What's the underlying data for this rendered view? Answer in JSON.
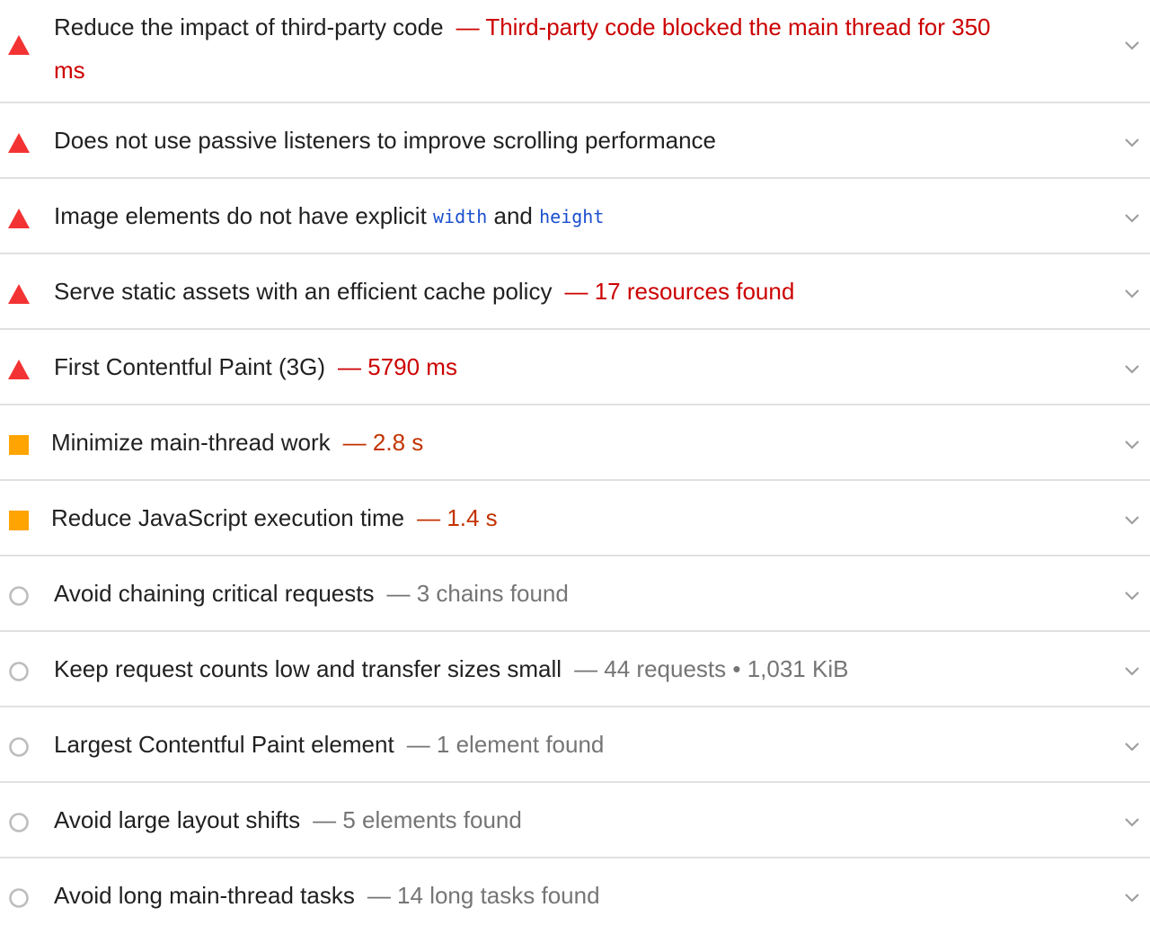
{
  "colors": {
    "fail": "#f33333",
    "fail_text": "#cc0000",
    "average": "#ffa400",
    "average_text": "#c33300",
    "informative": "#bdbdbd",
    "informative_text": "#757575",
    "chevron": "#9e9e9e",
    "divider": "#e0e0e0"
  },
  "audits": [
    {
      "status": "fail",
      "icon": "fail-triangle-icon",
      "title": "Reduce the impact of third-party code",
      "display_value": "— Third-party code blocked the main thread for 350 ms"
    },
    {
      "status": "fail",
      "icon": "fail-triangle-icon",
      "title": "Does not use passive listeners to improve scrolling performance",
      "display_value": ""
    },
    {
      "status": "fail",
      "icon": "fail-triangle-icon",
      "title_part1": "Image elements do not have explicit",
      "code1": "width",
      "title_part2": "and",
      "code2": "height",
      "display_value": ""
    },
    {
      "status": "fail",
      "icon": "fail-triangle-icon",
      "title": "Serve static assets with an efficient cache policy",
      "display_value": "— 17 resources found"
    },
    {
      "status": "fail",
      "icon": "fail-triangle-icon",
      "title": "First Contentful Paint (3G)",
      "display_value": "— 5790 ms"
    },
    {
      "status": "average",
      "icon": "average-square-icon",
      "title": "Minimize main-thread work",
      "display_value": "— 2.8 s"
    },
    {
      "status": "average",
      "icon": "average-square-icon",
      "title": "Reduce JavaScript execution time",
      "display_value": "— 1.4 s"
    },
    {
      "status": "informative",
      "icon": "informative-circle-icon",
      "title": "Avoid chaining critical requests",
      "display_value": "— 3 chains found"
    },
    {
      "status": "informative",
      "icon": "informative-circle-icon",
      "title": "Keep request counts low and transfer sizes small",
      "display_value": "— 44 requests • 1,031 KiB"
    },
    {
      "status": "informative",
      "icon": "informative-circle-icon",
      "title": "Largest Contentful Paint element",
      "display_value": "— 1 element found"
    },
    {
      "status": "informative",
      "icon": "informative-circle-icon",
      "title": "Avoid large layout shifts",
      "display_value": "— 5 elements found"
    },
    {
      "status": "informative",
      "icon": "informative-circle-icon",
      "title": "Avoid long main-thread tasks",
      "display_value": "— 14 long tasks found"
    }
  ]
}
